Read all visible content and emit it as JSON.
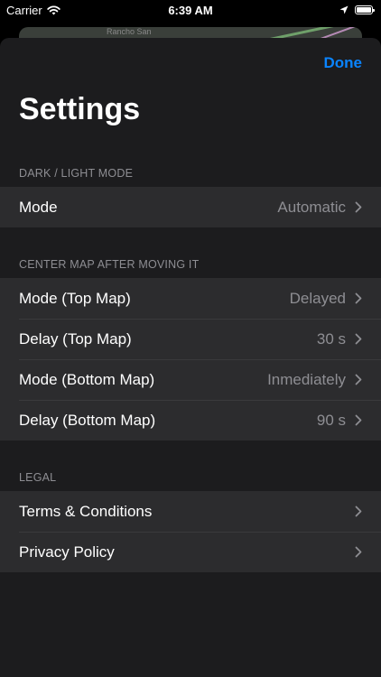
{
  "status_bar": {
    "carrier": "Carrier",
    "time": "6:39 AM"
  },
  "map_peek": {
    "label": "Rancho San"
  },
  "header": {
    "done_label": "Done",
    "title": "Settings"
  },
  "sections": {
    "appearance": {
      "header": "DARK / LIGHT MODE",
      "rows": [
        {
          "label": "Mode",
          "value": "Automatic"
        }
      ]
    },
    "center_map": {
      "header": "CENTER MAP AFTER MOVING IT",
      "rows": [
        {
          "label": "Mode (Top Map)",
          "value": "Delayed"
        },
        {
          "label": "Delay (Top Map)",
          "value": "30 s"
        },
        {
          "label": "Mode (Bottom Map)",
          "value": "Inmediately"
        },
        {
          "label": "Delay (Bottom Map)",
          "value": "90 s"
        }
      ]
    },
    "legal": {
      "header": "LEGAL",
      "rows": [
        {
          "label": "Terms & Conditions"
        },
        {
          "label": "Privacy Policy"
        }
      ]
    }
  },
  "colors": {
    "accent": "#0a84ff",
    "sheet_background": "#1c1c1e",
    "cell_background": "#2c2c2e",
    "secondary_text": "#8e8e93"
  }
}
